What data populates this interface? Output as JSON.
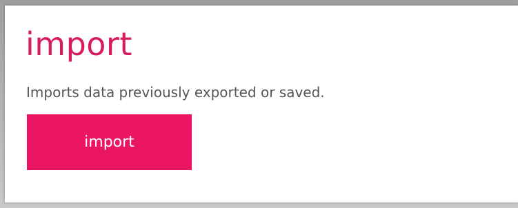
{
  "section": {
    "title": "import",
    "description": "Imports data previously exported or saved.",
    "button_label": "import"
  },
  "colors": {
    "title": "#d81b60",
    "button_background": "#ea1563",
    "button_text": "#ffffff",
    "description_text": "#555555"
  }
}
